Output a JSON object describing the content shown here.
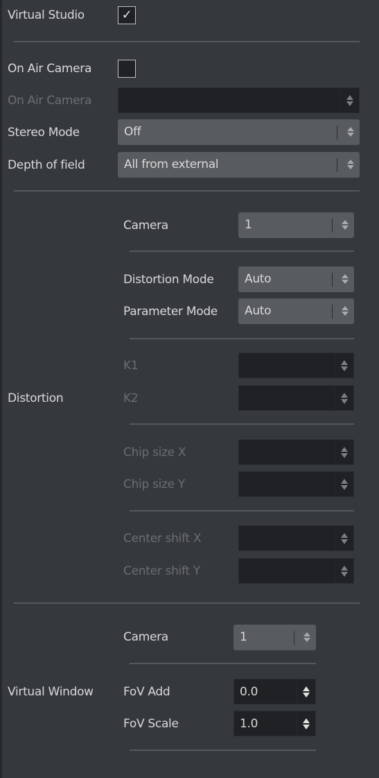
{
  "virtual_studio": {
    "label": "Virtual Studio",
    "checked": true,
    "check_glyph": "✓"
  },
  "on_air_camera": {
    "label": "On Air Camera",
    "checked": false
  },
  "on_air_camera_field": {
    "label": "On Air Camera",
    "value": "",
    "disabled": true
  },
  "stereo_mode": {
    "label": "Stereo Mode",
    "value": "Off"
  },
  "depth_of_field": {
    "label": "Depth of field",
    "value": "All from external"
  },
  "distortion": {
    "section_label": "Distortion",
    "camera": {
      "label": "Camera",
      "value": "1"
    },
    "distortion_mode": {
      "label": "Distortion Mode",
      "value": "Auto"
    },
    "parameter_mode": {
      "label": "Parameter Mode",
      "value": "Auto"
    },
    "k1": {
      "label": "K1",
      "value": ""
    },
    "k2": {
      "label": "K2",
      "value": ""
    },
    "chip_size_x": {
      "label": "Chip size X",
      "value": ""
    },
    "chip_size_y": {
      "label": "Chip size Y",
      "value": ""
    },
    "center_shift_x": {
      "label": "Center shift X",
      "value": ""
    },
    "center_shift_y": {
      "label": "Center shift Y",
      "value": ""
    }
  },
  "virtual_window": {
    "section_label": "Virtual Window",
    "camera": {
      "label": "Camera",
      "value": "1"
    },
    "fov_add": {
      "label": "FoV Add",
      "value": "0.0"
    },
    "fov_scale": {
      "label": "FoV Scale",
      "value": "1.0"
    }
  },
  "colors": {
    "background": "#35383d",
    "dropdown": "#585b5f",
    "input": "#1f2125",
    "text": "#d9d9d9",
    "disabled_text": "#6b6e73"
  }
}
